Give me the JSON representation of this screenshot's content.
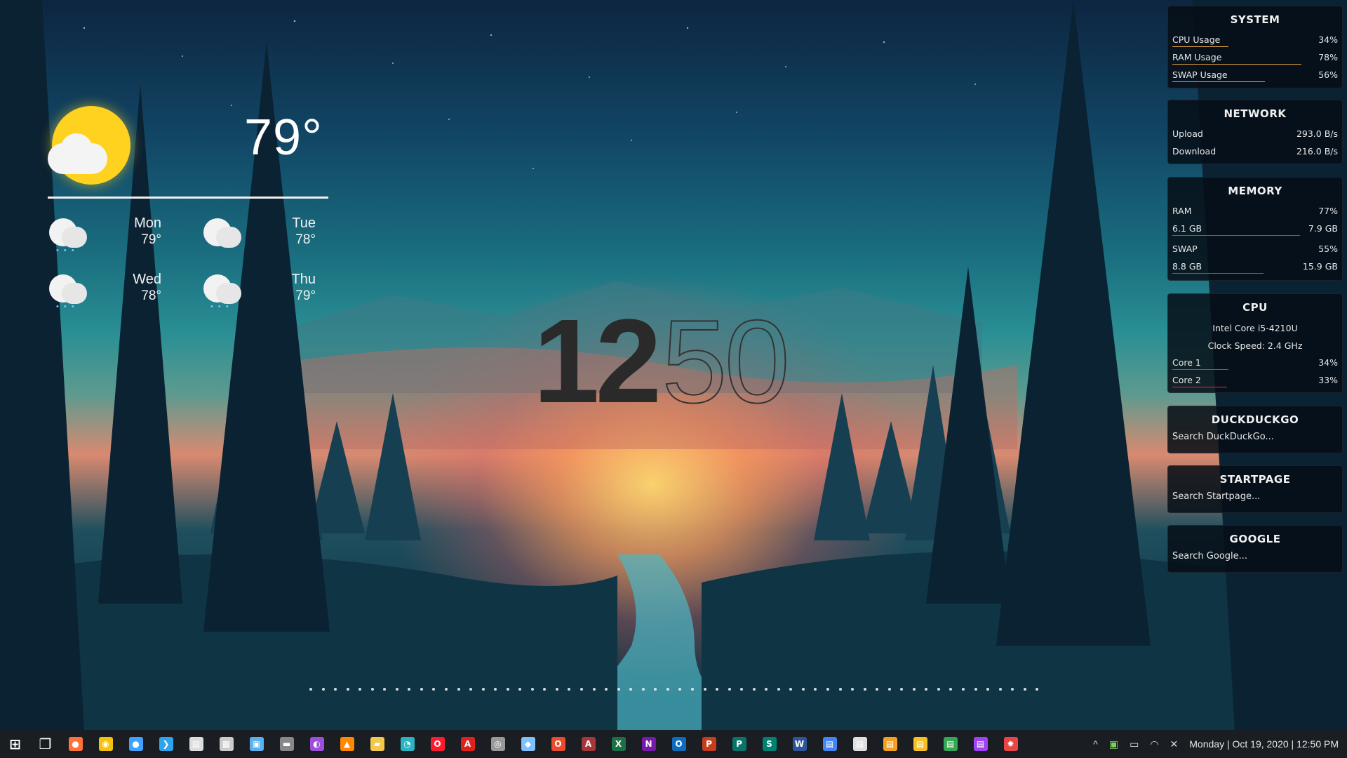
{
  "weather": {
    "current_temp": "79°",
    "current_icon": "partly-cloudy-sun-icon",
    "forecast": [
      {
        "day": "Mon",
        "temp": "79°",
        "icon": "rain-cloud-icon"
      },
      {
        "day": "Tue",
        "temp": "78°",
        "icon": "cloud-icon"
      },
      {
        "day": "Wed",
        "temp": "78°",
        "icon": "rain-cloud-icon"
      },
      {
        "day": "Thu",
        "temp": "79°",
        "icon": "rain-cloud-icon"
      }
    ]
  },
  "clock": {
    "hours": "12",
    "minutes": "50"
  },
  "system": {
    "title": "SYSTEM",
    "rows": [
      {
        "label": "CPU Usage",
        "value": "34%",
        "fraction": 0.34,
        "color": "#e6a23c"
      },
      {
        "label": "RAM Usage",
        "value": "78%",
        "fraction": 0.78,
        "color": "#e6a23c"
      },
      {
        "label": "SWAP Usage",
        "value": "56%",
        "fraction": 0.56,
        "color": "#e6a23c"
      }
    ]
  },
  "network": {
    "title": "NETWORK",
    "upload_label": "Upload",
    "upload_value": "293.0 B/s",
    "download_label": "Download",
    "download_value": "216.0 B/s"
  },
  "memory": {
    "title": "MEMORY",
    "ram_label": "RAM",
    "ram_percent": "77%",
    "ram_used": "6.1 GB",
    "ram_total": "7.9 GB",
    "ram_fraction": 0.77,
    "swap_label": "SWAP",
    "swap_percent": "55%",
    "swap_used": "8.8 GB",
    "swap_total": "15.9 GB",
    "swap_fraction": 0.55,
    "bar_color": "#e0303a"
  },
  "cpu": {
    "title": "CPU",
    "model": "Intel Core i5-4210U",
    "clock_speed": "Clock Speed: 2.4 GHz",
    "cores": [
      {
        "label": "Core 1",
        "value": "34%",
        "fraction": 0.34
      },
      {
        "label": "Core 2",
        "value": "33%",
        "fraction": 0.33
      }
    ],
    "bar_color": "#e0303a"
  },
  "search_panels": [
    {
      "title": "DUCKDUCKGO",
      "placeholder": "Search DuckDuckGo..."
    },
    {
      "title": "STARTPAGE",
      "placeholder": "Search Startpage..."
    },
    {
      "title": "GOOGLE",
      "placeholder": "Search Google..."
    }
  ],
  "taskbar": {
    "apps": [
      {
        "name": "start-icon",
        "color": "#ffffff",
        "glyph": "⊞"
      },
      {
        "name": "task-view-icon",
        "color": "#ffffff",
        "glyph": "❐"
      },
      {
        "name": "firefox-icon",
        "color": "#ff7139",
        "glyph": "●"
      },
      {
        "name": "chrome-icon",
        "color": "#f4c20d",
        "glyph": "◉"
      },
      {
        "name": "firefox-dev-icon",
        "color": "#3fa2ff",
        "glyph": "●"
      },
      {
        "name": "vscode-icon",
        "color": "#2fa4ee",
        "glyph": "❯"
      },
      {
        "name": "notepad-icon",
        "color": "#dddddd",
        "glyph": "▤"
      },
      {
        "name": "calculator-icon",
        "color": "#cccccc",
        "glyph": "▦"
      },
      {
        "name": "paint-icon",
        "color": "#5ab0f0",
        "glyph": "▣"
      },
      {
        "name": "terminal-icon",
        "color": "#888888",
        "glyph": "▬"
      },
      {
        "name": "tor-icon",
        "color": "#9d4edd",
        "glyph": "◐"
      },
      {
        "name": "vlc-icon",
        "color": "#ff8800",
        "glyph": "▲"
      },
      {
        "name": "file-explorer-icon",
        "color": "#f2c94c",
        "glyph": "▰"
      },
      {
        "name": "edge-icon",
        "color": "#2bb3c0",
        "glyph": "◔"
      },
      {
        "name": "opera-icon",
        "color": "#ff1b2d",
        "glyph": "O"
      },
      {
        "name": "acrobat-icon",
        "color": "#e0201b",
        "glyph": "A"
      },
      {
        "name": "controller-icon",
        "color": "#999999",
        "glyph": "◎"
      },
      {
        "name": "paint3d-icon",
        "color": "#7fc0ff",
        "glyph": "◆"
      },
      {
        "name": "office-icon",
        "color": "#e74c2c",
        "glyph": "O"
      },
      {
        "name": "access-icon",
        "color": "#a4373a",
        "glyph": "A"
      },
      {
        "name": "excel-icon",
        "color": "#1d7044",
        "glyph": "X"
      },
      {
        "name": "onenote-icon",
        "color": "#7719aa",
        "glyph": "N"
      },
      {
        "name": "outlook-icon",
        "color": "#0f6cbd",
        "glyph": "O"
      },
      {
        "name": "powerpoint-icon",
        "color": "#c43e1c",
        "glyph": "P"
      },
      {
        "name": "publisher-icon",
        "color": "#077568",
        "glyph": "P"
      },
      {
        "name": "sway-icon",
        "color": "#008272",
        "glyph": "S"
      },
      {
        "name": "word-icon",
        "color": "#2b579a",
        "glyph": "W"
      },
      {
        "name": "docs-icon",
        "color": "#4285f4",
        "glyph": "▤"
      },
      {
        "name": "file-icon",
        "color": "#e0e0e0",
        "glyph": "▤"
      },
      {
        "name": "slides-icon",
        "color": "#f4a020",
        "glyph": "▤"
      },
      {
        "name": "keep-icon",
        "color": "#f6c026",
        "glyph": "▤"
      },
      {
        "name": "sheets-icon",
        "color": "#34a853",
        "glyph": "▤"
      },
      {
        "name": "forms-icon",
        "color": "#a142f4",
        "glyph": "▤"
      },
      {
        "name": "settings-gear-icon",
        "color": "#e84545",
        "glyph": "✹"
      }
    ],
    "tray": {
      "chevron": "^",
      "battery_saver": "▣",
      "battery": "▭",
      "wifi": "◠",
      "volume_muted": "✕",
      "datetime": "Monday | Oct 19, 2020 | 12:50 PM"
    }
  }
}
